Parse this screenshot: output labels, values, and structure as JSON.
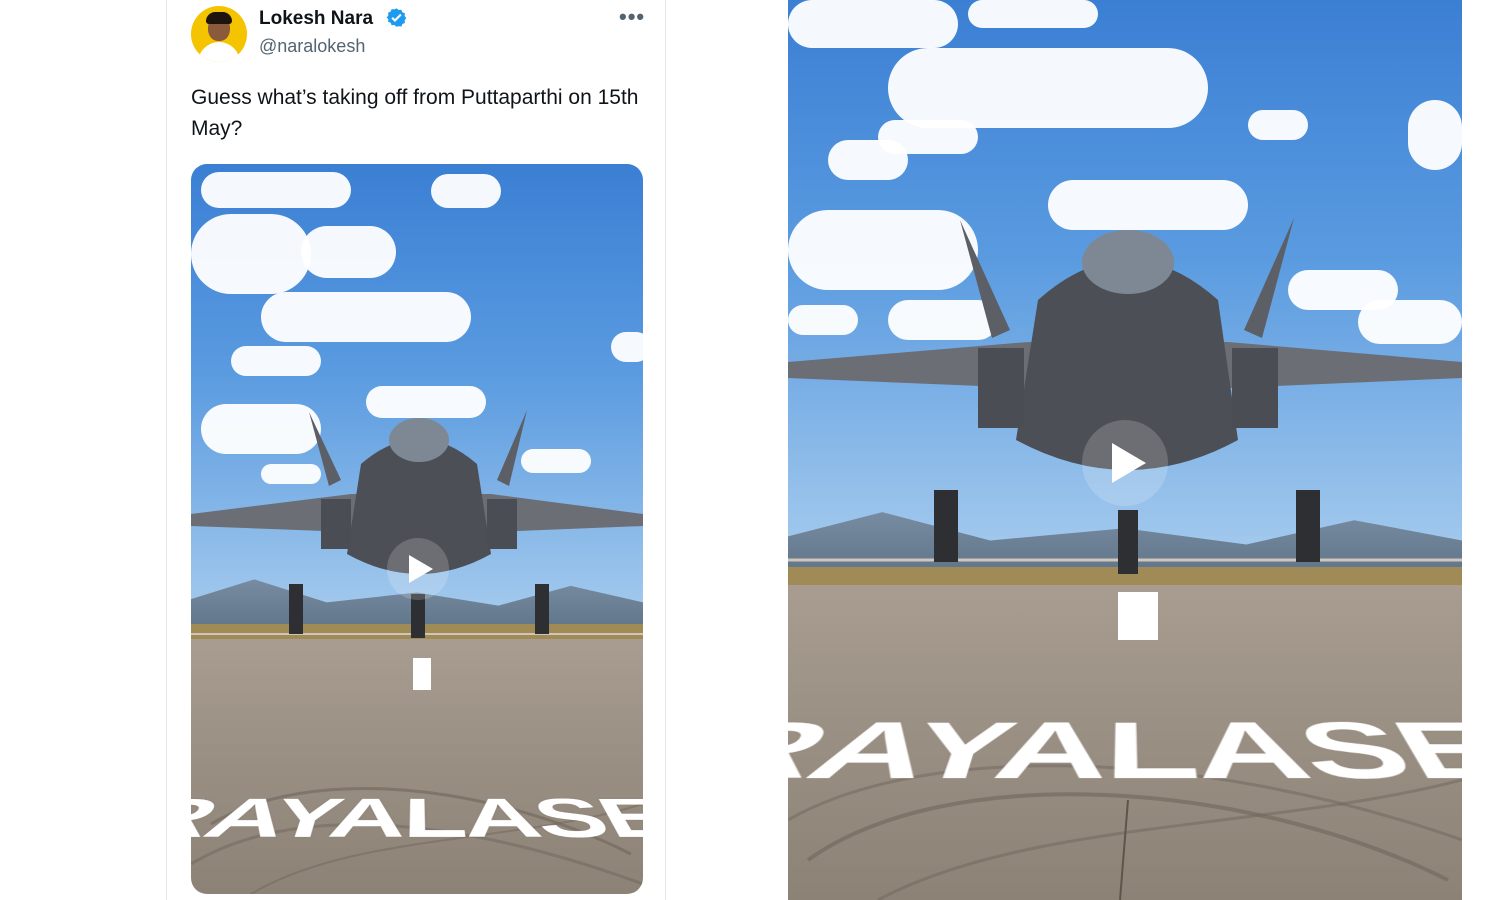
{
  "tweet": {
    "name": "Lokesh Nara",
    "handle": "@naralokesh",
    "text": "Guess what’s taking off from Puttaparthi on 15th May?",
    "more_icon": "more-options-icon",
    "verified_icon": "verified-badge-icon"
  },
  "media": {
    "runway_text": "RAYALASEEMA",
    "play_icon": "play-icon"
  },
  "colors": {
    "verified": "#1d9bf0",
    "avatar_bg": "#f4c400",
    "text_primary": "#0f1419",
    "text_secondary": "#536471"
  }
}
